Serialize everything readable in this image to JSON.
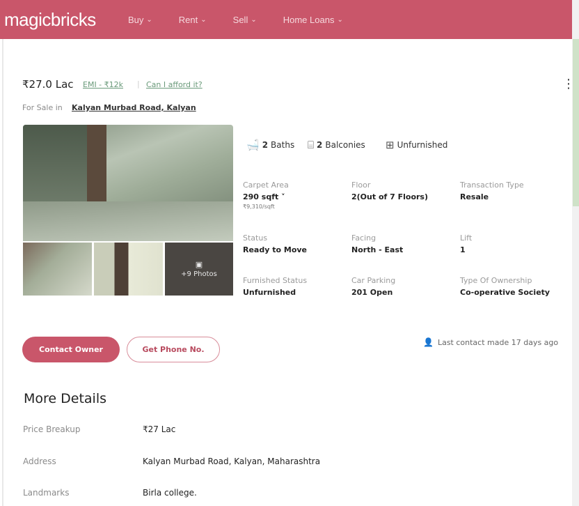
{
  "header": {
    "logo": "magicbricks",
    "nav": [
      {
        "label": "Buy"
      },
      {
        "label": "Rent"
      },
      {
        "label": "Sell"
      },
      {
        "label": "Home Loans"
      }
    ]
  },
  "listing": {
    "price": "₹27.0 Lac",
    "emi": "EMI - ₹12k",
    "afford": "Can I afford it?",
    "for_sale_prefix": "For Sale in",
    "location": "Kalyan Murbad Road, Kalyan",
    "more_photos": "+9 Photos",
    "amenities": [
      {
        "count": "2",
        "label": "Baths",
        "icon": "bathtub-icon"
      },
      {
        "count": "2",
        "label": "Balconies",
        "icon": "balcony-icon"
      },
      {
        "count": "",
        "label": "Unfurnished",
        "icon": "window-icon"
      }
    ],
    "specs": {
      "carpet_area": {
        "label": "Carpet Area",
        "value": "290 sqft",
        "sub": "₹9,310/sqft"
      },
      "floor": {
        "label": "Floor",
        "value": "2(Out of 7 Floors)"
      },
      "transaction": {
        "label": "Transaction Type",
        "value": "Resale"
      },
      "status": {
        "label": "Status",
        "value": "Ready to Move"
      },
      "facing": {
        "label": "Facing",
        "value": "North - East"
      },
      "lift": {
        "label": "Lift",
        "value": "1"
      },
      "furnished": {
        "label": "Furnished Status",
        "value": "Unfurnished"
      },
      "parking": {
        "label": "Car Parking",
        "value": "201 Open"
      },
      "ownership": {
        "label": "Type Of Ownership",
        "value": "Co-operative Society"
      }
    },
    "contact_button": "Contact Owner",
    "phone_button": "Get Phone No.",
    "last_contact": "Last contact made 17 days ago"
  },
  "more_details": {
    "title": "More Details",
    "rows": [
      {
        "label": "Price Breakup",
        "value": "₹27 Lac"
      },
      {
        "label": "Address",
        "value": "Kalyan Murbad Road, Kalyan, Maharashtra"
      },
      {
        "label": "Landmarks",
        "value": "Birla college."
      }
    ]
  },
  "colors": {
    "brand": "#c9566a",
    "link": "#6a9a7a"
  }
}
